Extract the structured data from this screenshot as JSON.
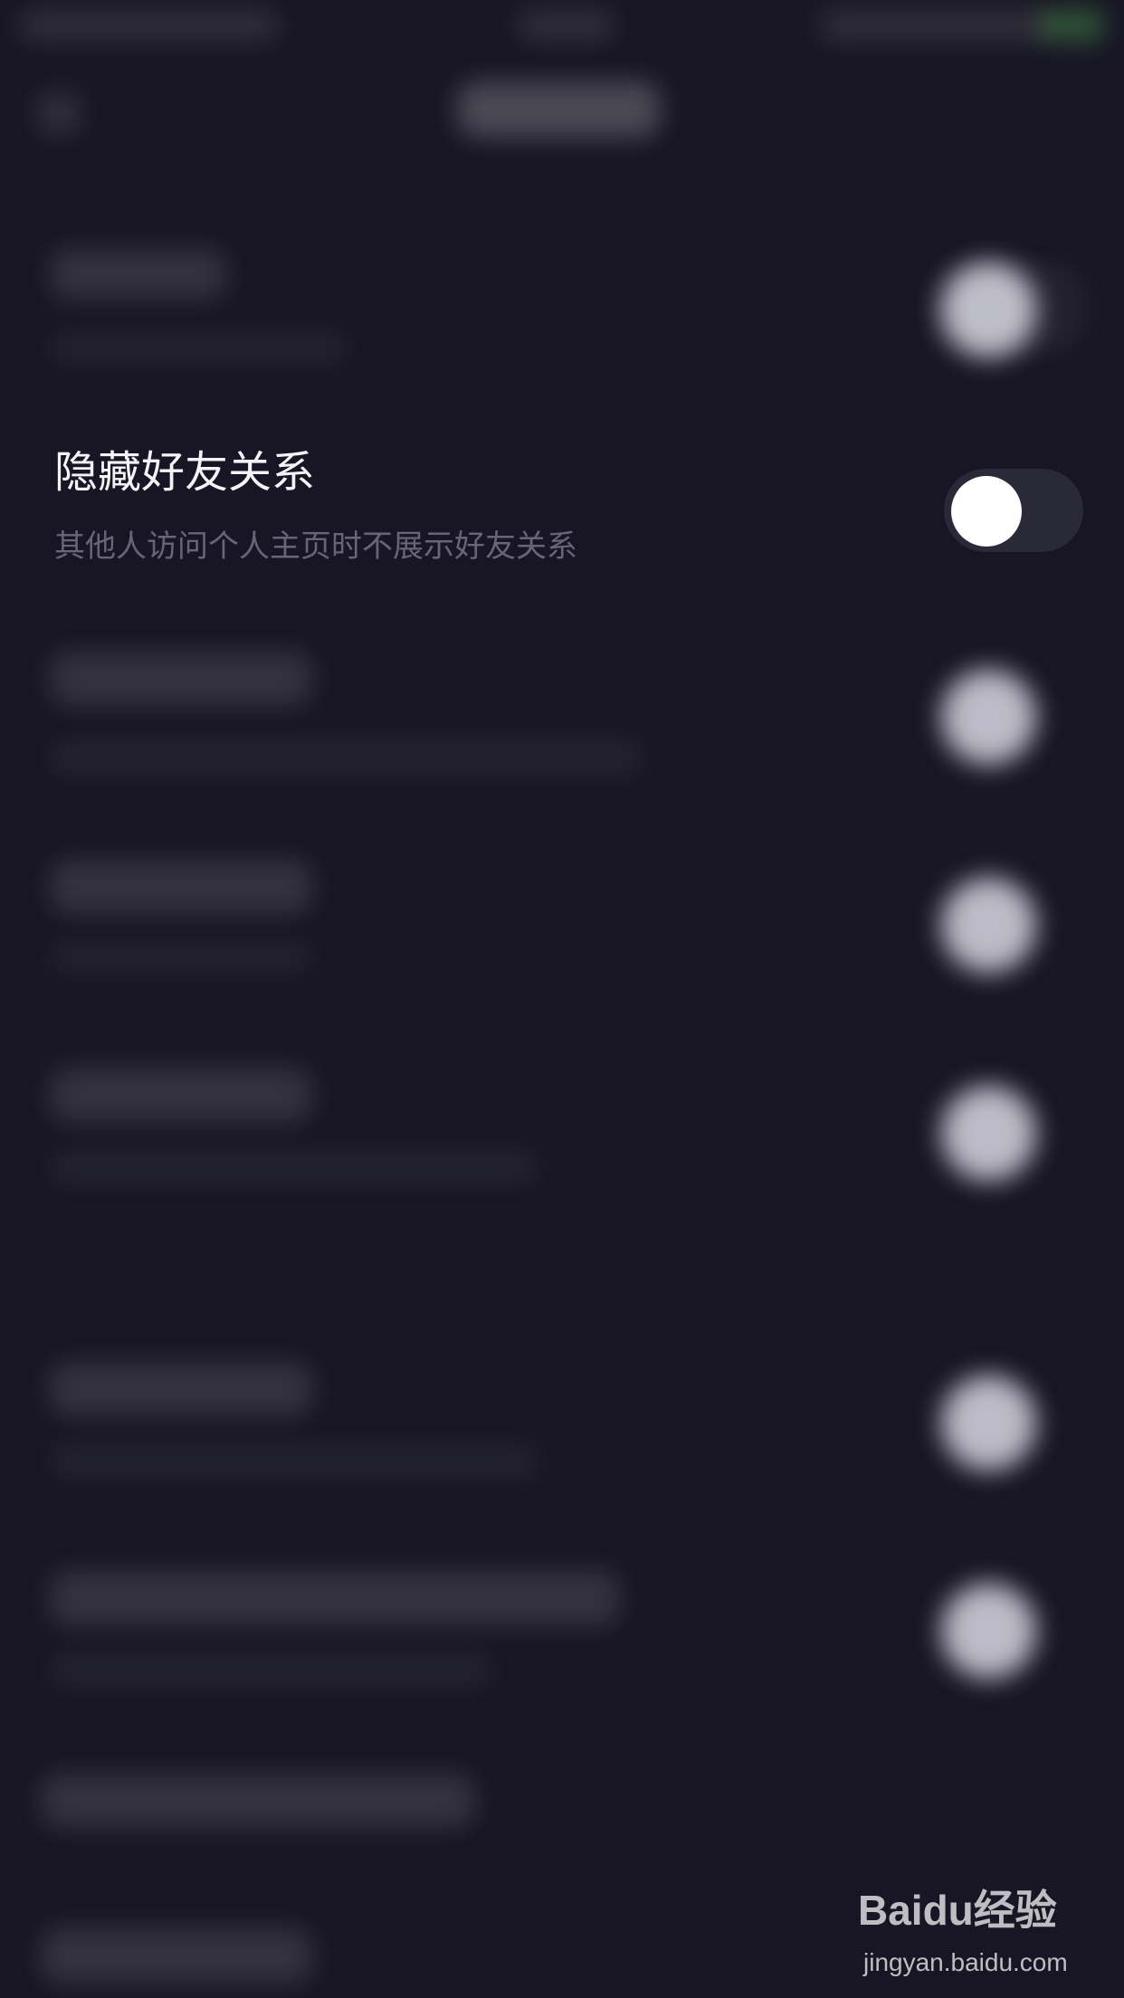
{
  "setting": {
    "title": "隐藏好友关系",
    "description": "其他人访问个人主页时不展示好友关系",
    "toggle_state": "off"
  },
  "watermark": {
    "brand": "Baidu经验",
    "url": "jingyan.baidu.com"
  }
}
